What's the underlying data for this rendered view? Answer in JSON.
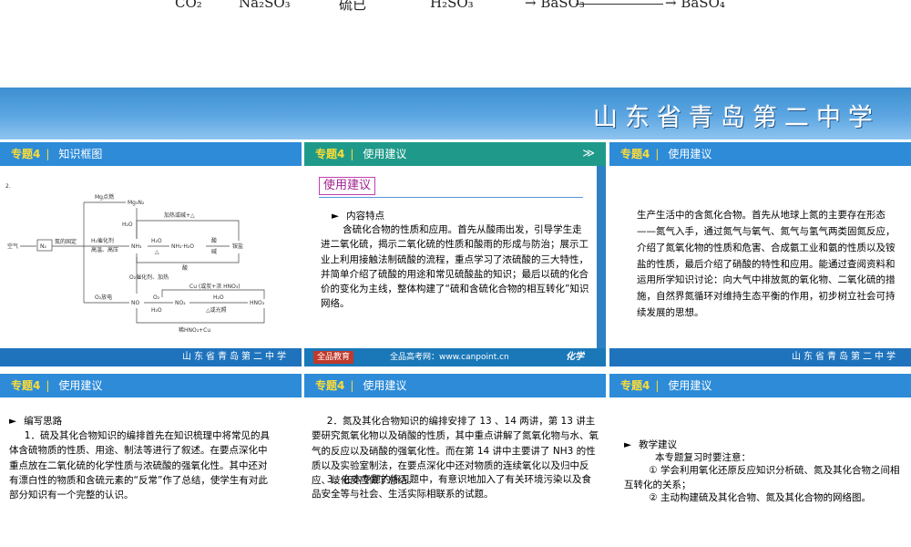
{
  "top_strip": {
    "formulas": [
      "CO₂",
      "Na₂SO₃",
      "硫已",
      "H₂SO₃",
      "→ BaSO₃",
      "→ BaSO₄"
    ]
  },
  "banner": {
    "school": "山东省青岛第二中学"
  },
  "panels": [
    {
      "tag": "专题4",
      "title": "知识框图",
      "footer": "山东省青岛第二中学",
      "diagram": {
        "number": "2.",
        "labels": {
          "air": "空气",
          "n2": "N₂",
          "fixation": "氮的固定",
          "mg_burn": "Mg点燃",
          "mg3n2": "Mg₃N₂",
          "h2o_1": "H₂O",
          "h2_cat": "H₂催化剂",
          "high_tp": "高温、高压",
          "nh3": "NH₃",
          "h2o_2": "H₂O",
          "delta_1": "△",
          "nh3h2o": "NH₃·H₂O",
          "acid_1": "酸",
          "base": "碱",
          "salt": "铵盐",
          "heat_base": "加热或碱+△",
          "acid_2": "酸",
          "o2_cat": "O₂催化剂、加热",
          "cu_acid": "Cu (或炭+浓 HNO₃)",
          "o2_discharge": "O₂放电",
          "no": "NO",
          "o2": "O₂",
          "h2o_3": "H₂O",
          "no2": "NO₂",
          "h2o_4": "H₂O",
          "light": "△或光照",
          "hno3": "HNO₃",
          "dilute": "稀HNO₃+Cu"
        }
      }
    },
    {
      "tag": "专题4",
      "title": "使用建议",
      "use_label": "使用建议",
      "heading": "内容特点",
      "body": "含硫化合物的性质和应用。首先从酸雨出发，引导学生走进二氧化硫，揭示二氧化硫的性质和酸雨的形成与防治；展示工业上利用接触法制硫酸的流程，重点学习了浓硫酸的三大特性，并简单介绍了硫酸的用途和常见硫酸盐的知识；最后以硫的化合价的变化为主线，整体构建了“硫和含硫化合物的相互转化”知识网络。",
      "footer_logo": "全品教育",
      "footer_site": "全品高考网：www.canpoint.cn",
      "footer_subject": "化学"
    },
    {
      "tag": "专题4",
      "title": "使用建议",
      "footer": "山东省青岛第二中学",
      "body": "生产生活中的含氮化合物。首先从地球上氮的主要存在形态——氮气入手，通过氮气与氧气、氮气与氢气两类固氮反应，介绍了氮氧化物的性质和危害、合成氨工业和氨的性质以及铵盐的性质，最后介绍了硝酸的特性和应用。能通过查阅资料和运用所学知识讨论：向大气中排放氮的氧化物、二氧化硫的措施，自然界氮循环对维持生态平衡的作用，初步树立社会可持续发展的思想。"
    },
    {
      "tag": "专题4",
      "title": "使用建议",
      "heading": "编写思路",
      "body": "1．硫及其化合物知识的编排首先在知识梳理中将常见的具体含硫物质的性质、用途、制法等进行了叙述。在要点深化中重点放在二氧化硫的化学性质与浓硫酸的强氧化性。其中还对有漂白性的物质和含硫元素的“反常”作了总结，使学生有对此部分知识有一个完整的认识。"
    },
    {
      "tag": "专题4",
      "title": "使用建议",
      "body1": "2．氮及其化合物知识的编排安排了 13 、14 两讲，第 13 讲主要研究氮氧化物以及硝酸的性质，其中重点讲解了氮氧化物与水、氧气的反应以及硝酸的强氧化性。而在第 14 讲中主要讲了 NH3 的性质以及实验室制法，在要点深化中还对物质的连续氧化以及归中反应、歧化反应做了总结。",
      "body2": "3．在本专题的练习题中，有意识地加入了有关环境污染以及食品安全等与社会、生活实际相联系的试题。"
    },
    {
      "tag": "专题4",
      "title": "使用建议",
      "heading": "教学建议",
      "intro": "本专题复习时要注意：",
      "point1": "① 学会利用氧化还原反应知识分析硫、氮及其化合物之间相互转化的关系；",
      "point2": "② 主动构建硫及其化合物、氮及其化合物的网络图。"
    }
  ],
  "bullet": "►",
  "separator": "|",
  "colors": {
    "header_blue": "#2d8bd8",
    "header_teal": "#1f9a8a",
    "footer_blue": "#1f73bd",
    "tag_yellow": "#ffdd33",
    "usebox_magenta": "#a0208e"
  }
}
